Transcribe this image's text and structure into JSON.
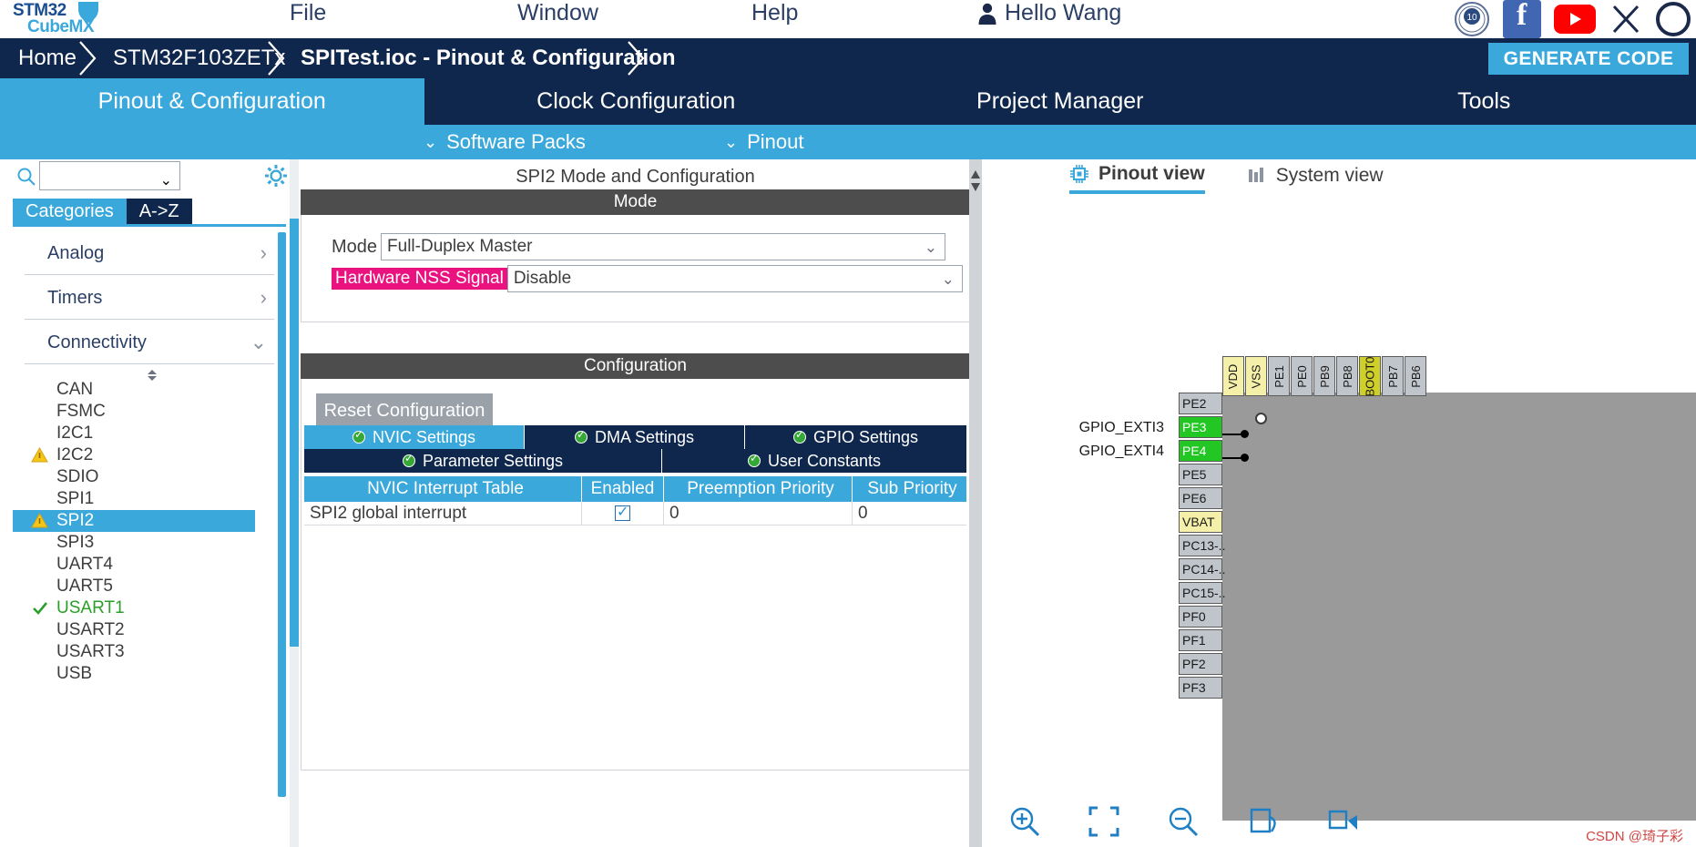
{
  "app": {
    "logo_line1": "STM32",
    "logo_line2": "CubeMX"
  },
  "menubar": {
    "items": [
      {
        "label": "File",
        "name": "menu-file"
      },
      {
        "label": "Window",
        "name": "menu-window"
      },
      {
        "label": "Help",
        "name": "menu-help"
      }
    ],
    "user_greeting": "Hello Wang",
    "user_icon": "user-icon",
    "social_icons": [
      {
        "name": "anniversary-10-years-badge-icon",
        "label": "10"
      },
      {
        "name": "facebook-icon",
        "label": "f"
      },
      {
        "name": "youtube-icon",
        "label": "▶"
      },
      {
        "name": "x-twitter-icon",
        "label": "X"
      },
      {
        "name": "social-circle-icon",
        "label": ""
      }
    ]
  },
  "breadcrumb": {
    "home": "Home",
    "mcu": "STM32F103ZETx",
    "file": "SPITest.ioc - Pinout & Configuration",
    "generate_code": "GENERATE CODE"
  },
  "main_tabs": [
    {
      "label": "Pinout & Configuration",
      "active": true
    },
    {
      "label": "Clock Configuration",
      "active": false
    },
    {
      "label": "Project Manager",
      "active": false
    },
    {
      "label": "Tools",
      "active": false
    }
  ],
  "sub_tabs": [
    {
      "label": "Software Packs",
      "caret": "⌄"
    },
    {
      "label": "Pinout",
      "caret": "⌄"
    }
  ],
  "sidebar": {
    "search_placeholder": "",
    "search_value": "",
    "search_icon": "search-icon",
    "gear_icon": "gear-icon",
    "tabs": [
      {
        "label": "Categories",
        "selected": true
      },
      {
        "label": "A->Z",
        "selected": false
      }
    ],
    "groups": [
      {
        "label": "Analog",
        "arrow": "›",
        "expanded": false
      },
      {
        "label": "Timers",
        "arrow": "›",
        "expanded": false
      },
      {
        "label": "Connectivity",
        "arrow": "⌄",
        "expanded": true
      }
    ],
    "connectivity_items": [
      {
        "label": "CAN",
        "status": "none",
        "selected": false
      },
      {
        "label": "FSMC",
        "status": "none",
        "selected": false
      },
      {
        "label": "I2C1",
        "status": "none",
        "selected": false
      },
      {
        "label": "I2C2",
        "status": "warning",
        "selected": false
      },
      {
        "label": "SDIO",
        "status": "none",
        "selected": false
      },
      {
        "label": "SPI1",
        "status": "none",
        "selected": false
      },
      {
        "label": "SPI2",
        "status": "warning",
        "selected": true
      },
      {
        "label": "SPI3",
        "status": "none",
        "selected": false
      },
      {
        "label": "UART4",
        "status": "none",
        "selected": false
      },
      {
        "label": "UART5",
        "status": "none",
        "selected": false
      },
      {
        "label": "USART1",
        "status": "ok",
        "selected": false
      },
      {
        "label": "USART2",
        "status": "none",
        "selected": false
      },
      {
        "label": "USART3",
        "status": "none",
        "selected": false
      },
      {
        "label": "USB",
        "status": "none",
        "selected": false
      }
    ]
  },
  "center": {
    "panel_title": "SPI2 Mode and Configuration",
    "mode_section_header": "Mode",
    "mode_label": "Mode",
    "mode_value": "Full-Duplex Master",
    "nss_label": "Hardware NSS Signal",
    "nss_value": "Disable",
    "nss_highlight_color": "#e9127f",
    "config_section_header": "Configuration",
    "reset_button": "Reset Configuration",
    "config_tabs_row1": [
      {
        "label": "NVIC Settings",
        "active": true
      },
      {
        "label": "DMA Settings",
        "active": false
      },
      {
        "label": "GPIO Settings",
        "active": false
      }
    ],
    "config_tabs_row2": [
      {
        "label": "Parameter Settings",
        "active": false
      },
      {
        "label": "User Constants",
        "active": false
      }
    ],
    "nvic_table": {
      "headers": [
        "NVIC Interrupt Table",
        "Enabled",
        "Preemption Priority",
        "Sub Priority"
      ],
      "rows": [
        {
          "name": "SPI2 global interrupt",
          "enabled": true,
          "preemption": "0",
          "sub": "0"
        }
      ]
    }
  },
  "right": {
    "view_tabs": [
      {
        "label": "Pinout view",
        "icon": "chip-icon",
        "active": true
      },
      {
        "label": "System view",
        "icon": "system-view-icon",
        "active": false
      }
    ],
    "top_pins": [
      {
        "label": "VDD",
        "style": "yellow"
      },
      {
        "label": "VSS",
        "style": "yellow"
      },
      {
        "label": "PE1",
        "style": "grey"
      },
      {
        "label": "PE0",
        "style": "grey"
      },
      {
        "label": "PB9",
        "style": "grey"
      },
      {
        "label": "PB8",
        "style": "grey"
      },
      {
        "label": "BOOT0",
        "style": "khaki"
      },
      {
        "label": "PB7",
        "style": "grey"
      },
      {
        "label": "PB6",
        "style": "grey"
      }
    ],
    "left_pins": [
      {
        "label": "PE2",
        "style": "grey",
        "signal": ""
      },
      {
        "label": "PE3",
        "style": "green",
        "signal": "GPIO_EXTI3"
      },
      {
        "label": "PE4",
        "style": "green",
        "signal": "GPIO_EXTI4"
      },
      {
        "label": "PE5",
        "style": "grey",
        "signal": ""
      },
      {
        "label": "PE6",
        "style": "grey",
        "signal": ""
      },
      {
        "label": "VBAT",
        "style": "yellow",
        "signal": ""
      },
      {
        "label": "PC13-..",
        "style": "grey",
        "signal": ""
      },
      {
        "label": "PC14-..",
        "style": "grey",
        "signal": ""
      },
      {
        "label": "PC15-..",
        "style": "grey",
        "signal": ""
      },
      {
        "label": "PF0",
        "style": "grey",
        "signal": ""
      },
      {
        "label": "PF1",
        "style": "grey",
        "signal": ""
      },
      {
        "label": "PF2",
        "style": "grey",
        "signal": ""
      },
      {
        "label": "PF3",
        "style": "grey",
        "signal": ""
      }
    ],
    "toolbar_icons": [
      {
        "name": "zoom-in-icon"
      },
      {
        "name": "fit-to-screen-icon"
      },
      {
        "name": "zoom-out-icon"
      },
      {
        "name": "rotate-icon"
      },
      {
        "name": "export-icon"
      }
    ],
    "watermark": "CSDN @琦子彩"
  }
}
